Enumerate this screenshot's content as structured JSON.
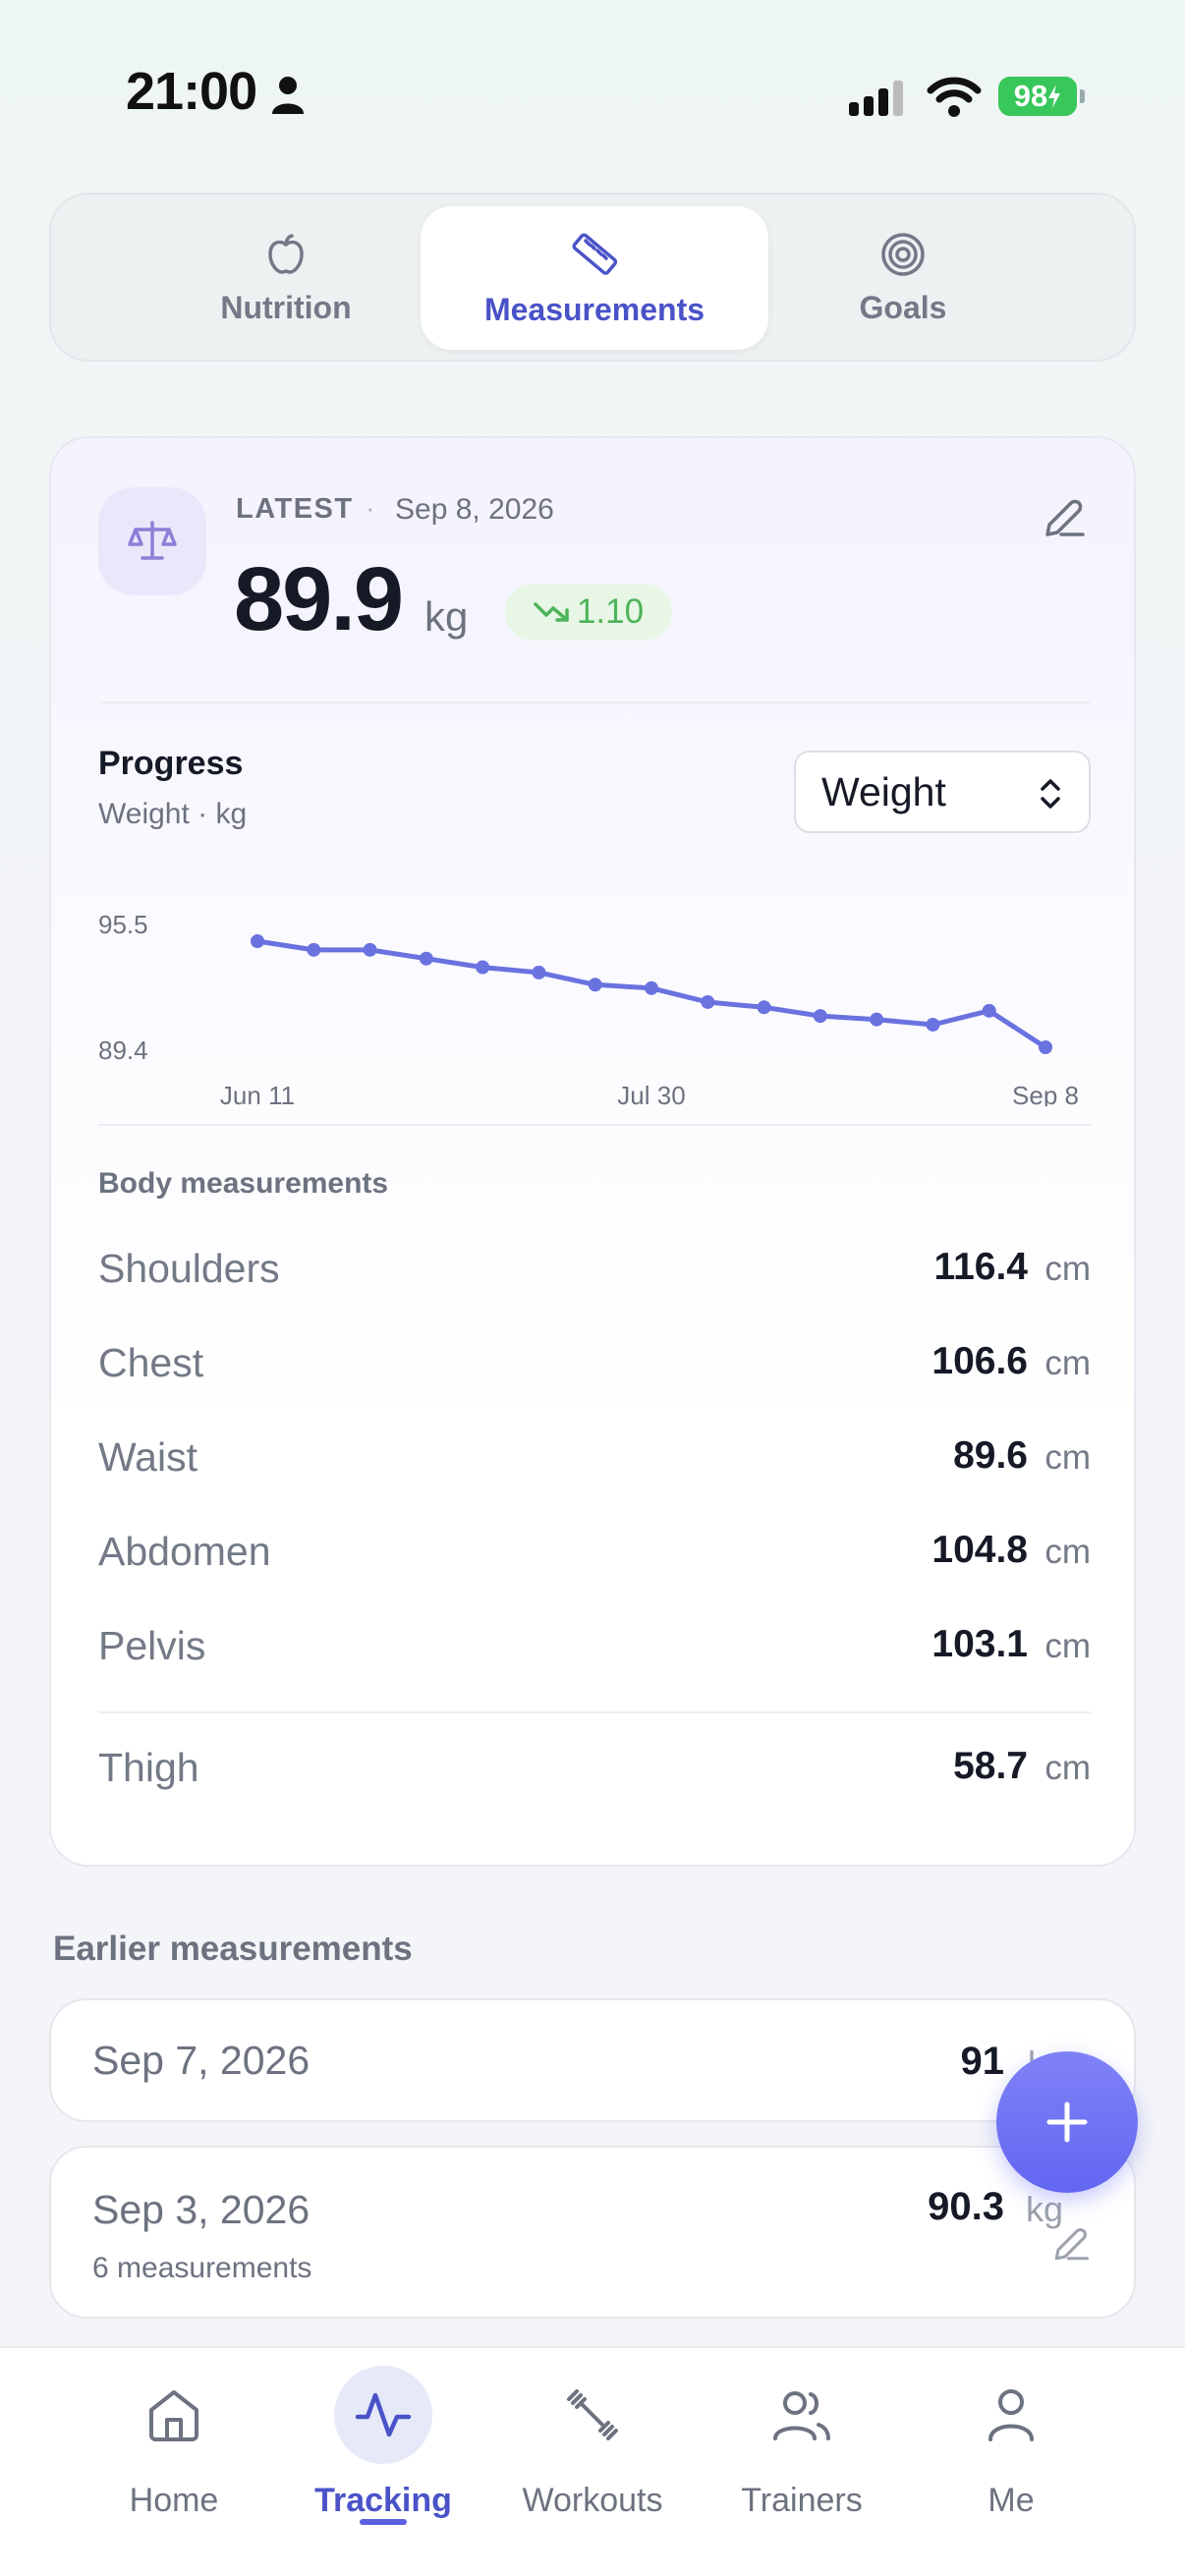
{
  "status_bar": {
    "time": "21:00",
    "battery": "98"
  },
  "tabs": [
    {
      "label": "Nutrition",
      "icon": "apple-icon"
    },
    {
      "label": "Measurements",
      "icon": "ruler-icon",
      "active": true
    },
    {
      "label": "Goals",
      "icon": "target-icon"
    }
  ],
  "latest": {
    "label": "LATEST",
    "date": "Sep 8, 2026",
    "value": "89.9",
    "unit": "kg",
    "delta": "1.10",
    "delta_trend": "down"
  },
  "progress": {
    "title": "Progress",
    "subtitle": "Weight · kg",
    "selected_metric": "Weight"
  },
  "chart_data": {
    "type": "line",
    "x": [
      "Jun 11",
      "Jun 18",
      "Jun 25",
      "Jul 2",
      "Jul 9",
      "Jul 16",
      "Jul 23",
      "Jul 30",
      "Aug 6",
      "Aug 13",
      "Aug 20",
      "Aug 27",
      "Sep 3",
      "Sep 7",
      "Sep 8"
    ],
    "values": [
      95.5,
      95.0,
      95.0,
      94.5,
      94.0,
      93.7,
      93.0,
      92.8,
      92.0,
      91.7,
      91.2,
      91.0,
      90.7,
      91.5,
      89.4
    ],
    "y_labels": [
      "95.5",
      "89.4"
    ],
    "x_tick_labels": [
      "Jun 11",
      "Jul 30",
      "Sep 8"
    ],
    "ylim": [
      89.4,
      95.5
    ],
    "grid": false,
    "color": "#6a72e0"
  },
  "body": {
    "title": "Body measurements",
    "items": [
      {
        "name": "Shoulders",
        "value": "116.4",
        "unit": "cm"
      },
      {
        "name": "Chest",
        "value": "106.6",
        "unit": "cm"
      },
      {
        "name": "Waist",
        "value": "89.6",
        "unit": "cm"
      },
      {
        "name": "Abdomen",
        "value": "104.8",
        "unit": "cm"
      },
      {
        "name": "Pelvis",
        "value": "103.1",
        "unit": "cm"
      },
      {
        "name": "Thigh",
        "value": "58.7",
        "unit": "cm"
      }
    ]
  },
  "earlier": {
    "title": "Earlier measurements",
    "items": [
      {
        "date": "Sep 7, 2026",
        "value": "91",
        "unit": "kg",
        "sub": ""
      },
      {
        "date": "Sep 3, 2026",
        "value": "90.3",
        "unit": "kg",
        "sub": "6 measurements"
      }
    ]
  },
  "nav": [
    {
      "label": "Home",
      "icon": "home-icon"
    },
    {
      "label": "Tracking",
      "icon": "activity-icon",
      "active": true
    },
    {
      "label": "Workouts",
      "icon": "dumbbell-icon"
    },
    {
      "label": "Trainers",
      "icon": "users-icon"
    },
    {
      "label": "Me",
      "icon": "user-icon"
    }
  ],
  "colors": {
    "accent": "#4a52c8",
    "fab": "#6366f1",
    "positive": "#4cb45a"
  }
}
